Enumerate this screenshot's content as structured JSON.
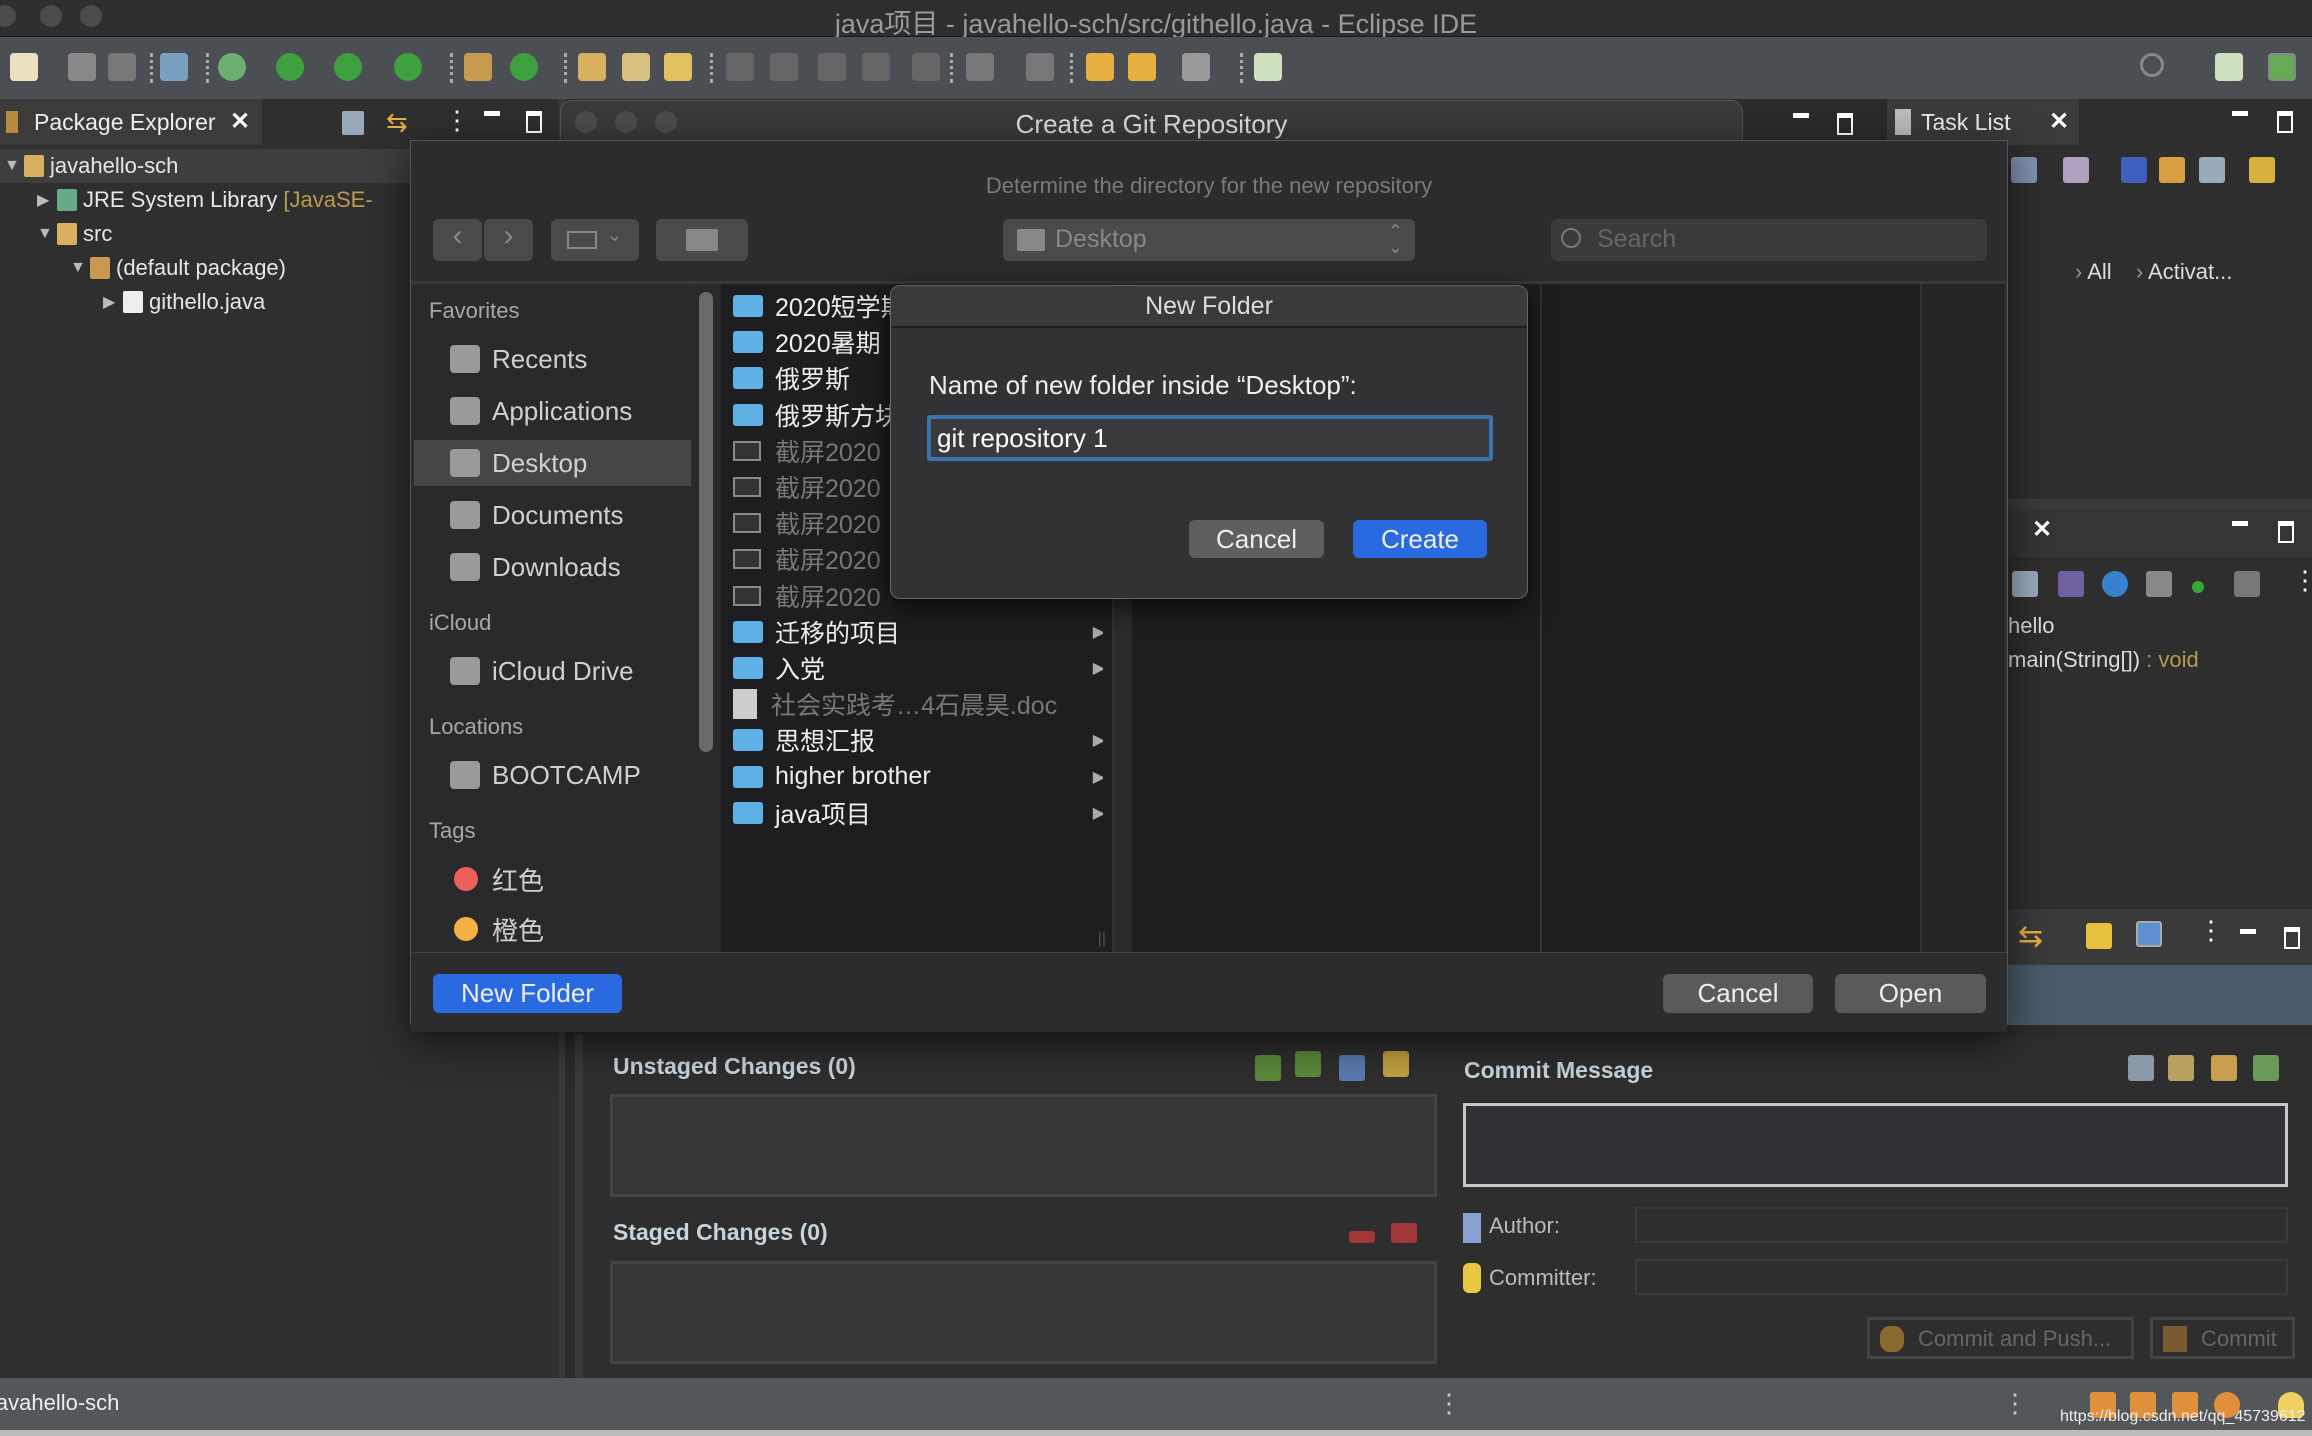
{
  "window": {
    "title": "java项目 - javahello-sch/src/githello.java - Eclipse IDE"
  },
  "toolbar": {
    "icons": [
      {
        "name": "new-icon",
        "color": "#e8e0c0"
      },
      {
        "name": "save-icon",
        "color": "#888"
      },
      {
        "name": "save-all-icon",
        "color": "#777"
      },
      {
        "name": "skip-breakpoints-icon",
        "color": "#7aa0c0"
      },
      {
        "name": "debug-icon",
        "color": "#6cb070"
      },
      {
        "name": "run-icon",
        "color": "#3fa040"
      },
      {
        "name": "coverage-icon",
        "color": "#3fa040"
      },
      {
        "name": "run-external-icon",
        "color": "#3fa040"
      },
      {
        "name": "new-package-icon",
        "color": "#c89a50"
      },
      {
        "name": "new-class-icon",
        "color": "#3fa040"
      },
      {
        "name": "open-type-icon",
        "color": "#d8b060"
      },
      {
        "name": "open-task-icon",
        "color": "#d8c080"
      },
      {
        "name": "search-pen-icon",
        "color": "#e0c060"
      },
      {
        "name": "toggle-annotation-icon",
        "color": "#666"
      },
      {
        "name": "mark-occurrences-icon",
        "color": "#666"
      },
      {
        "name": "block-select-icon",
        "color": "#666"
      },
      {
        "name": "whitespace-icon",
        "color": "#666"
      },
      {
        "name": "pilcrow-icon",
        "color": "#666"
      },
      {
        "name": "next-annotation-icon",
        "color": "#777"
      },
      {
        "name": "prev-annotation-icon",
        "color": "#777"
      },
      {
        "name": "last-edit-icon",
        "color": "#e8b040"
      },
      {
        "name": "back-icon",
        "color": "#e8b040"
      },
      {
        "name": "forward-icon",
        "color": "#999"
      },
      {
        "name": "open-perspective-icon",
        "color": "#cfe0c0"
      }
    ]
  },
  "package_explorer": {
    "tab": "Package Explorer",
    "tree": [
      {
        "label": "javahello-sch",
        "depth": 0,
        "expanded": true,
        "icon": "project-icon",
        "selected": true
      },
      {
        "label": "JRE System Library",
        "suffix": "[JavaSE-",
        "depth": 1,
        "expanded": false,
        "icon": "library-icon"
      },
      {
        "label": "src",
        "depth": 1,
        "expanded": true,
        "icon": "source-folder-icon"
      },
      {
        "label": "(default package)",
        "depth": 2,
        "expanded": true,
        "icon": "package-icon"
      },
      {
        "label": "githello.java",
        "depth": 3,
        "expanded": false,
        "icon": "java-file-icon"
      }
    ]
  },
  "git_window": {
    "title": "Create a Git Repository"
  },
  "file_dialog": {
    "subtitle": "Determine the directory for the new repository",
    "location": "Desktop",
    "search_placeholder": "Search",
    "sidebar": [
      {
        "header": "Favorites",
        "items": [
          {
            "label": "Recents",
            "icon": "recents-icon"
          },
          {
            "label": "Applications",
            "icon": "applications-icon"
          },
          {
            "label": "Desktop",
            "icon": "desktop-icon",
            "selected": true
          },
          {
            "label": "Documents",
            "icon": "documents-icon"
          },
          {
            "label": "Downloads",
            "icon": "downloads-icon"
          }
        ]
      },
      {
        "header": "iCloud",
        "items": [
          {
            "label": "iCloud Drive",
            "icon": "cloud-icon"
          }
        ]
      },
      {
        "header": "Locations",
        "items": [
          {
            "label": "BOOTCAMP",
            "icon": "disk-icon"
          }
        ]
      },
      {
        "header": "Tags",
        "items": [
          {
            "label": "红色",
            "icon": "tag-red-icon",
            "color": "#ee5e5a"
          },
          {
            "label": "橙色",
            "icon": "tag-orange-icon",
            "color": "#f4b044"
          }
        ]
      }
    ],
    "files": [
      {
        "name": "2020短学期",
        "type": "folder"
      },
      {
        "name": "2020暑期",
        "type": "folder"
      },
      {
        "name": "俄罗斯",
        "type": "folder"
      },
      {
        "name": "俄罗斯方块",
        "type": "folder"
      },
      {
        "name": "截屏2020",
        "type": "image"
      },
      {
        "name": "截屏2020",
        "type": "image"
      },
      {
        "name": "截屏2020",
        "type": "image"
      },
      {
        "name": "截屏2020",
        "type": "image"
      },
      {
        "name": "截屏2020",
        "type": "image"
      },
      {
        "name": "迁移的项目",
        "type": "folder",
        "arrow": true
      },
      {
        "name": "入党",
        "type": "folder",
        "arrow": true
      },
      {
        "name": "社会实践考…4石晨昊.doc",
        "type": "doc"
      },
      {
        "name": "思想汇报",
        "type": "folder",
        "arrow": true
      },
      {
        "name": "higher brother",
        "type": "folder",
        "arrow": true
      },
      {
        "name": "java项目",
        "type": "folder",
        "arrow": true
      }
    ],
    "new_folder_button": "New Folder",
    "cancel_button": "Cancel",
    "open_button": "Open"
  },
  "new_folder_dialog": {
    "title": "New Folder",
    "label": "Name of new folder inside “Desktop”:",
    "value": "git repository 1",
    "cancel": "Cancel",
    "create": "Create",
    "accent": "#2a6ae0"
  },
  "task_list": {
    "tab": "Task List",
    "filters": [
      "All",
      "Activat..."
    ]
  },
  "outline": {
    "items": [
      "hello",
      "main(String[])"
    ],
    "type_suffix": " : void"
  },
  "git_staging": {
    "unstaged": "Unstaged Changes (0)",
    "staged": "Staged Changes (0)",
    "commit_message": "Commit Message",
    "author_label": "Author:",
    "committer_label": "Committer:",
    "commit_and_push": "Commit and Push...",
    "commit": "Commit"
  },
  "status_bar": {
    "text": "javahello-sch",
    "watermark": "https://blog.csdn.net/qq_45739612"
  }
}
